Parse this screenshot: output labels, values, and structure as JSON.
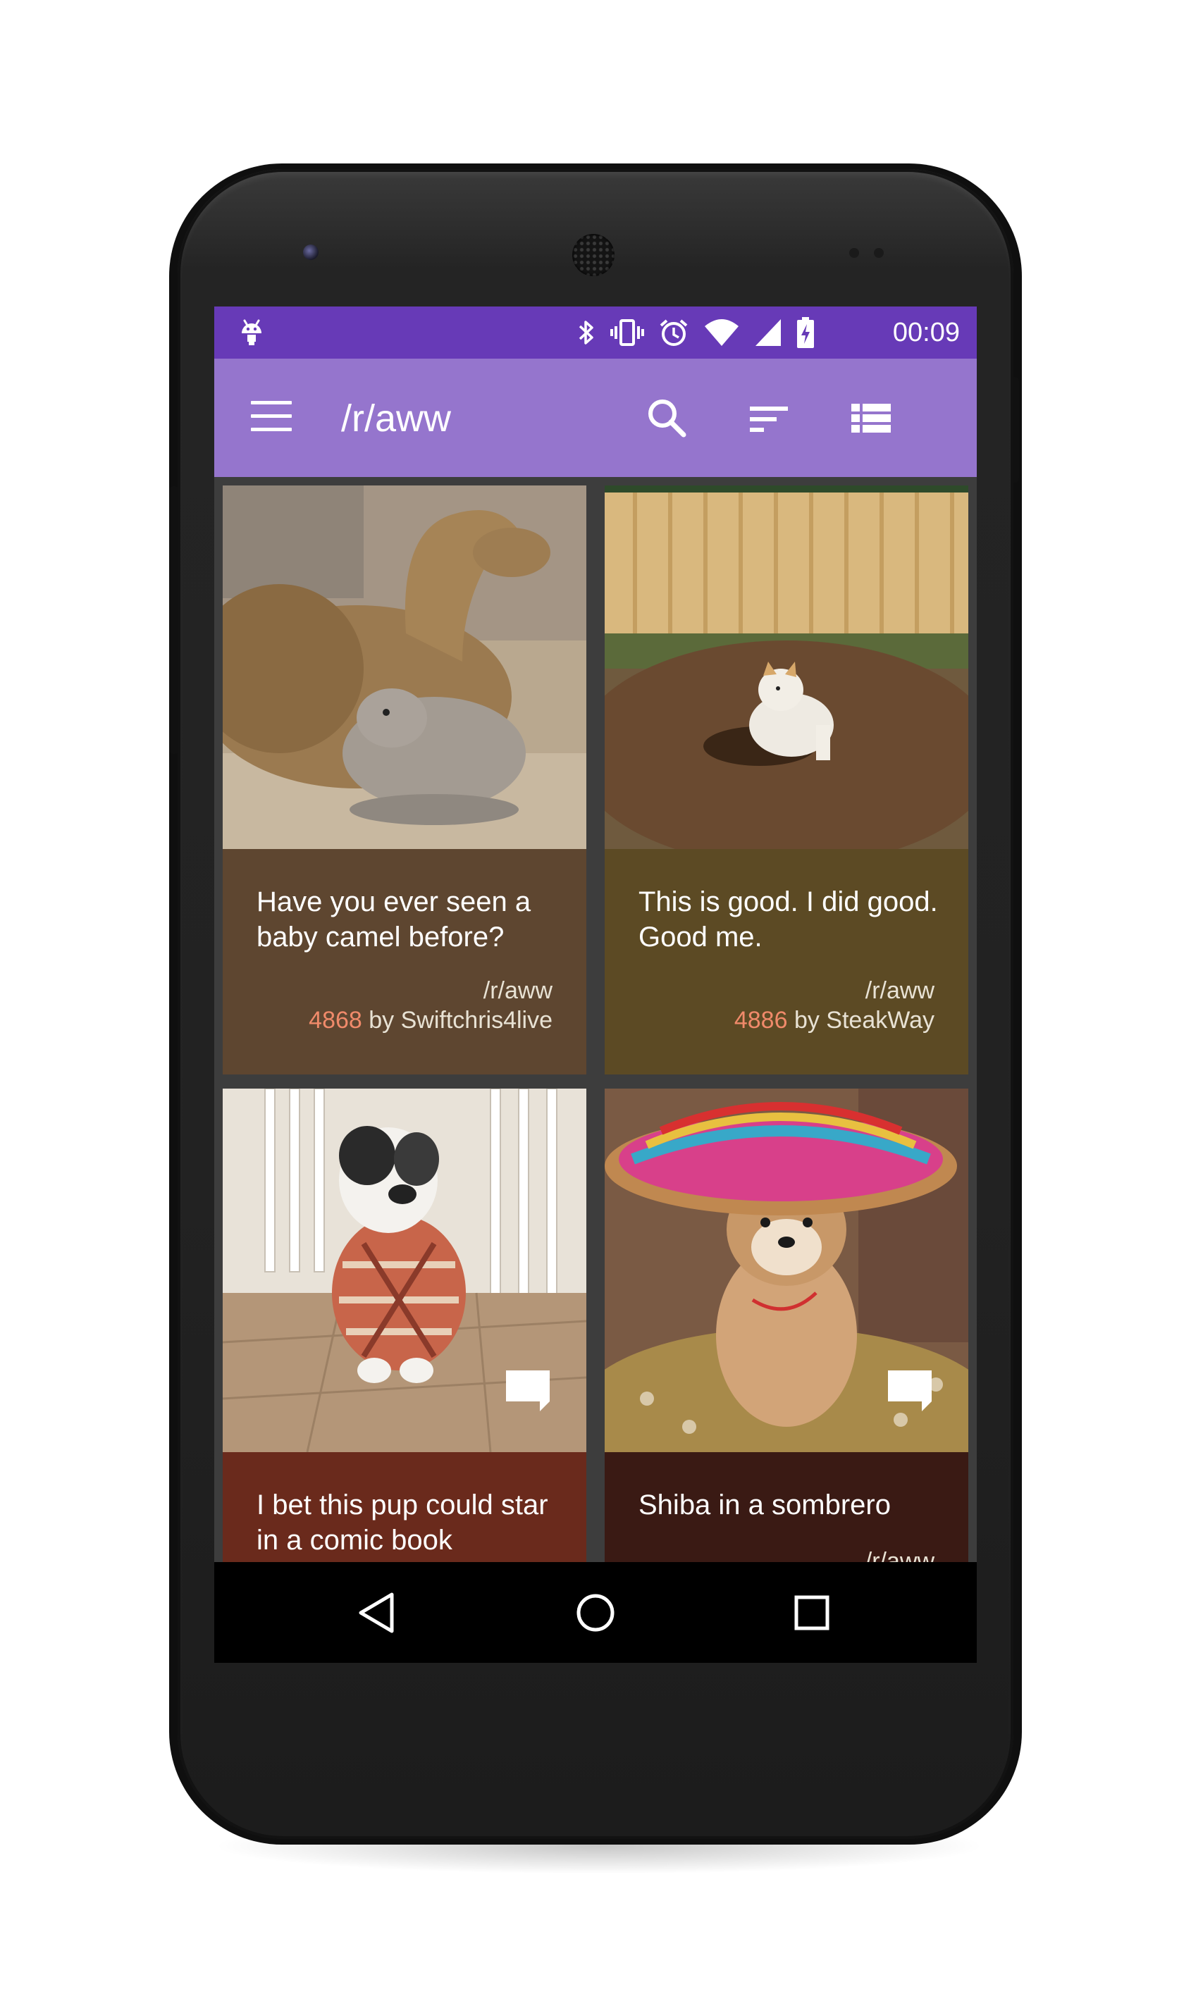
{
  "status_bar": {
    "time": "00:09",
    "icons": [
      "android-debug-icon",
      "bluetooth-icon",
      "vibrate-icon",
      "alarm-icon",
      "wifi-icon",
      "signal-icon",
      "battery-charging-icon"
    ]
  },
  "app_bar": {
    "title": "/r/aww",
    "menu_icon": "menu-icon",
    "actions": [
      "search-icon",
      "sort-icon",
      "view-list-icon"
    ]
  },
  "posts": [
    {
      "title": "Have you ever seen a baby camel before?",
      "subreddit": "/r/aww",
      "score": "4868",
      "by_label": "by Swiftchris4live",
      "card_color": "#5e4630"
    },
    {
      "title": "This is good. I did good. Good me.",
      "subreddit": "/r/aww",
      "score": "4886",
      "by_label": "by SteakWay",
      "card_color": "#5c4a24"
    },
    {
      "title": "I bet this pup could star in a comic book",
      "subreddit": "",
      "score": "",
      "by_label": "",
      "card_color": "#6a2a1c"
    },
    {
      "title": "Shiba in a sombrero",
      "subreddit": "/r/aww",
      "score": "",
      "by_label": "",
      "card_color": "#3a1a14"
    }
  ],
  "nav_bar": {
    "buttons": [
      "back-icon",
      "home-icon",
      "recents-icon"
    ]
  },
  "colors": {
    "status_bar": "#673ab7",
    "app_bar": "#9575cd",
    "score_accent": "#f08a6a"
  }
}
